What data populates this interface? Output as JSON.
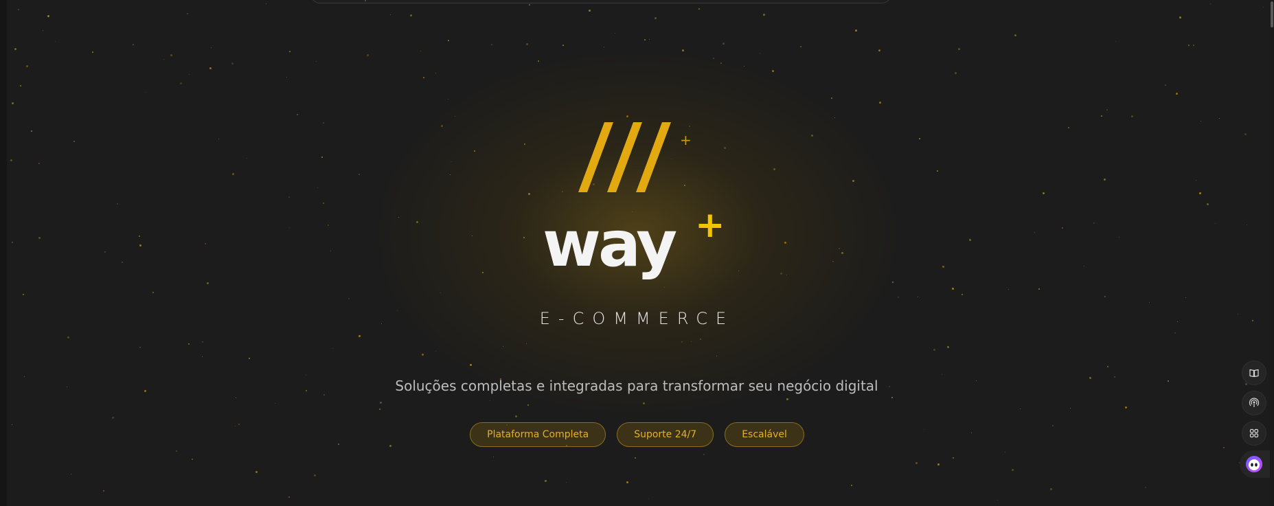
{
  "brand": {
    "name": "way",
    "name_plus": "+",
    "slashes": "///",
    "slashes_plus": "+",
    "tagline": "E-COMMERCE",
    "accent": "#e2a910",
    "plus_color": "#f2c400"
  },
  "hero": {
    "subtitle": "Soluções completas e integradas para transformar seu negócio digital"
  },
  "badges": [
    {
      "label": "Plataforma Completa"
    },
    {
      "label": "Suporte 24/7"
    },
    {
      "label": "Escalável"
    }
  ],
  "side_tools": [
    {
      "icon": "book-icon"
    },
    {
      "icon": "broadcast-icon"
    },
    {
      "icon": "apps-icon"
    }
  ],
  "assistant": {
    "icon": "assistant-face-icon"
  }
}
